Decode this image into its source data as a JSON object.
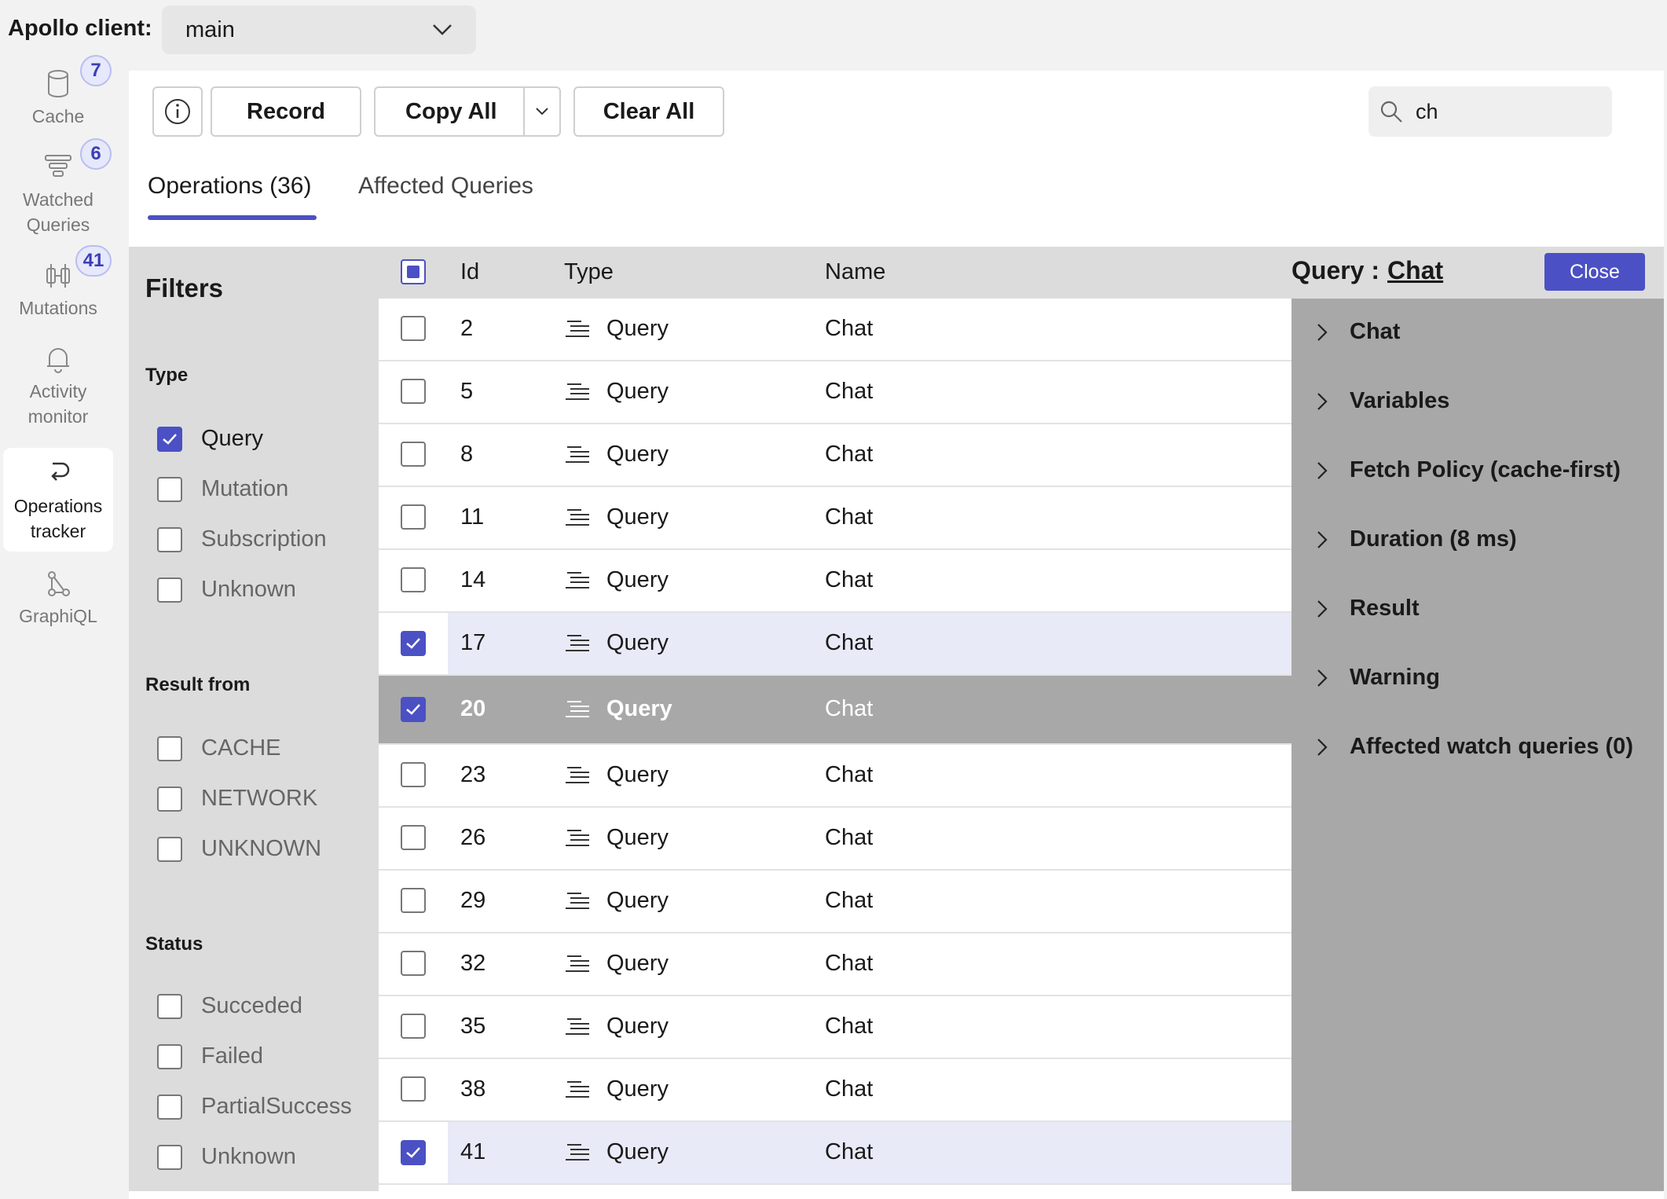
{
  "client": {
    "label": "Apollo client:",
    "selected": "main"
  },
  "nav": {
    "cache": {
      "label": "Cache",
      "badge": "7"
    },
    "watched": {
      "label1": "Watched",
      "label2": "Queries",
      "badge": "6"
    },
    "mutations": {
      "label": "Mutations",
      "badge": "41"
    },
    "activity": {
      "label1": "Activity",
      "label2": "monitor"
    },
    "ops": {
      "label1": "Operations",
      "label2": "tracker"
    },
    "graphiql": {
      "label": "GraphiQL"
    }
  },
  "toolbar": {
    "record": "Record",
    "copy_all": "Copy All",
    "clear_all": "Clear All",
    "search_value": "ch"
  },
  "tabs": {
    "operations": "Operations (36)",
    "affected": "Affected Queries"
  },
  "filters": {
    "title": "Filters",
    "type_title": "Type",
    "type_options": [
      "Query",
      "Mutation",
      "Subscription",
      "Unknown"
    ],
    "result_title": "Result from",
    "result_options": [
      "CACHE",
      "NETWORK",
      "UNKNOWN"
    ],
    "status_title": "Status",
    "status_options": [
      "Succeded",
      "Failed",
      "PartialSuccess",
      "Unknown"
    ]
  },
  "table": {
    "headers": {
      "id": "Id",
      "type": "Type",
      "name": "Name"
    },
    "rows": [
      {
        "id": "2",
        "type": "Query",
        "name": "Chat"
      },
      {
        "id": "5",
        "type": "Query",
        "name": "Chat"
      },
      {
        "id": "8",
        "type": "Query",
        "name": "Chat"
      },
      {
        "id": "11",
        "type": "Query",
        "name": "Chat"
      },
      {
        "id": "14",
        "type": "Query",
        "name": "Chat"
      },
      {
        "id": "17",
        "type": "Query",
        "name": "Chat"
      },
      {
        "id": "20",
        "type": "Query",
        "name": "Chat"
      },
      {
        "id": "23",
        "type": "Query",
        "name": "Chat"
      },
      {
        "id": "26",
        "type": "Query",
        "name": "Chat"
      },
      {
        "id": "29",
        "type": "Query",
        "name": "Chat"
      },
      {
        "id": "32",
        "type": "Query",
        "name": "Chat"
      },
      {
        "id": "35",
        "type": "Query",
        "name": "Chat"
      },
      {
        "id": "38",
        "type": "Query",
        "name": "Chat"
      },
      {
        "id": "41",
        "type": "Query",
        "name": "Chat"
      }
    ]
  },
  "detail": {
    "title_prefix": "Query :",
    "title_link": "Chat",
    "close": "Close",
    "items": [
      "Chat",
      "Variables",
      "Fetch Policy (cache-first)",
      "Duration (8 ms)",
      "Result",
      "Warning",
      "Affected watch queries (0)"
    ]
  },
  "colors": {
    "accent": "#4b50c4",
    "selected_row": "#e8eaf8",
    "current_row": "#a8a8a8"
  }
}
